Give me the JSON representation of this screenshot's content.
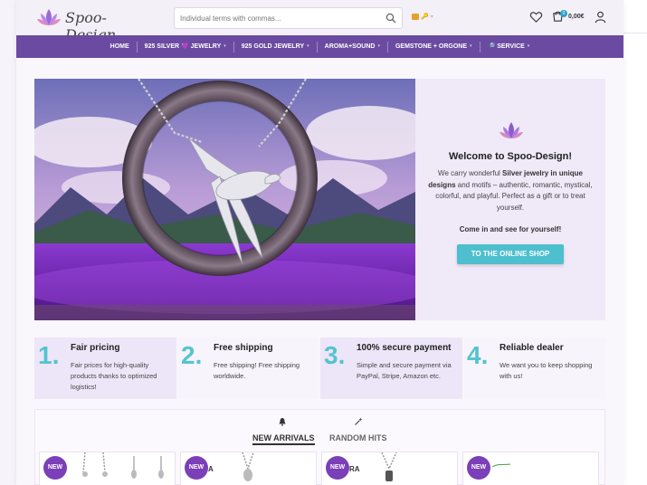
{
  "header": {
    "brand": "Spoo-Design",
    "search_placeholder": "Individual terms with commas...",
    "cart_count": "0",
    "cart_total": "0,00€"
  },
  "nav": {
    "items": [
      {
        "label": "HOME"
      },
      {
        "label": "925 SILVER 💜 JEWELRY"
      },
      {
        "label": "925 GOLD JEWELRY"
      },
      {
        "label": "AROMA+SOUND"
      },
      {
        "label": "GEMSTONE + ORGONE"
      },
      {
        "label": "🔎 SERVICE"
      }
    ]
  },
  "hero": {
    "title": "Welcome to Spoo-Design!",
    "desc_1": "We carry wonderful ",
    "desc_bold": "Silver jewelry in unique designs",
    "desc_2": " and motifs – authentic, romantic, mystical, colorful, and playful. Perfect as a gift or to treat yourself.",
    "invite": "Come in and see for yourself!",
    "button": "TO THE ONLINE SHOP"
  },
  "features": [
    {
      "num": "1.",
      "title": "Fair pricing",
      "desc": "Fair prices for high-quality products thanks to optimized logistics!"
    },
    {
      "num": "2.",
      "title": "Free shipping",
      "desc": "Free shipping! Free shipping worldwide."
    },
    {
      "num": "3.",
      "title": "100% secure payment",
      "desc": "Simple and secure payment via PayPal, Stripe, Amazon etc."
    },
    {
      "num": "4.",
      "title": "Reliable dealer",
      "desc": "We want you to keep shopping with us!"
    }
  ],
  "products": {
    "tabs": [
      {
        "label": "NEW ARRIVALS",
        "icon": "bell-icon",
        "active": true
      },
      {
        "label": "RANDOM HITS",
        "icon": "magic-wand-icon",
        "active": false
      }
    ],
    "cards": [
      {
        "badge": "NEW"
      },
      {
        "badge": "NEW",
        "partial_text": "A"
      },
      {
        "badge": "NEW",
        "partial_text": "RA"
      },
      {
        "badge": "NEW"
      }
    ]
  },
  "colors": {
    "nav_bg": "#6b4ba1",
    "accent_teal": "#4dbfce",
    "badge_purple": "#7b3fb8",
    "feature_number": "#55c3d1"
  }
}
